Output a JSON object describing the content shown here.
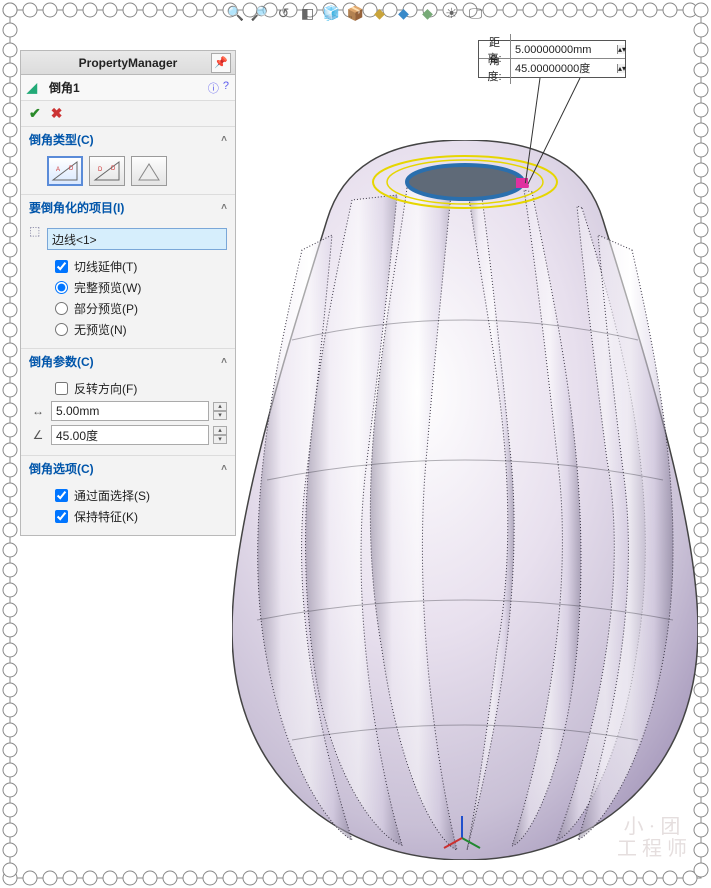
{
  "pm": {
    "title": "PropertyManager",
    "feature_name": "倒角1",
    "sections": {
      "type": {
        "header": "倒角类型(C)"
      },
      "items": {
        "header": "要倒角化的项目(I)",
        "selection": "边线<1>",
        "tangent": "切线延伸(T)",
        "full_preview": "完整预览(W)",
        "partial_preview": "部分预览(P)",
        "no_preview": "无预览(N)"
      },
      "params": {
        "header": "倒角参数(C)",
        "reverse": "反转方向(F)",
        "distance": "5.00mm",
        "angle": "45.00度"
      },
      "options": {
        "header": "倒角选项(C)",
        "sel_faces": "通过面选择(S)",
        "keep_feat": "保持特征(K)"
      }
    }
  },
  "callout": {
    "dist_label": "距离:",
    "dist_value": "5.00000000mm",
    "ang_label": "角度:",
    "ang_value": "45.00000000度"
  },
  "watermark_top": "小 · 团",
  "watermark_bot": "工 程 师"
}
